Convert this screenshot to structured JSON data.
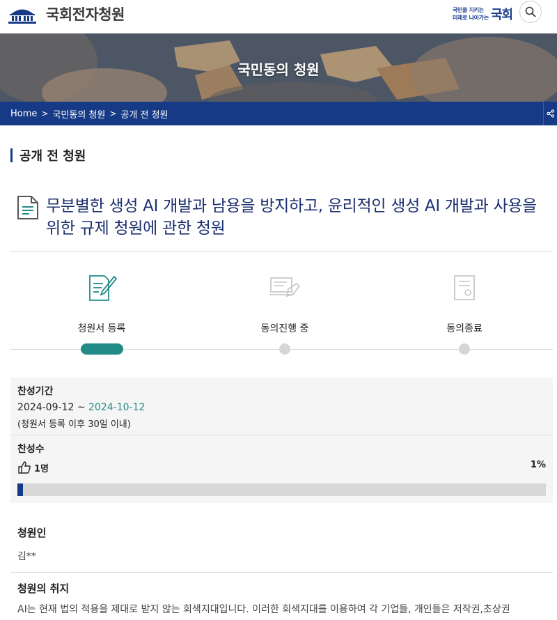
{
  "header": {
    "site_title": "국회전자청원",
    "slogan_line1": "국민을 지키는",
    "slogan_line2": "미래로 나아가는",
    "slogan_big": "국회",
    "search_icon": "search-icon"
  },
  "banner": {
    "title": "국민동의 청원"
  },
  "breadcrumb": {
    "items": [
      "Home",
      "국민동의 청원",
      "공개 전 청원"
    ],
    "separator": ">"
  },
  "section": {
    "title": "공개 전 청원"
  },
  "petition": {
    "title": "무분별한 생성 AI 개발과 남용을 방지하고, 윤리적인 생성 AI 개발과 사용을 위한 규제 청원에 관한 청원"
  },
  "steps": {
    "items": [
      {
        "label": "청원서 등록",
        "icon": "document-pen-icon",
        "active": true
      },
      {
        "label": "동의진행 중",
        "icon": "signing-icon",
        "active": false
      },
      {
        "label": "동의종료",
        "icon": "certificate-icon",
        "active": false
      }
    ]
  },
  "agreement": {
    "period_heading": "찬성기간",
    "period_start": "2024-09-12",
    "period_sep": "~",
    "period_end": "2024-10-12",
    "period_note": "(청원서 등록 이후 30일 이내)",
    "count_heading": "찬성수",
    "count_value": "1명",
    "percent_label": "1%",
    "progress_fraction": 0.01,
    "colors": {
      "accent": "#238b87",
      "navy": "#163a86"
    }
  },
  "petitioner": {
    "heading": "청원인",
    "name": "김**"
  },
  "purpose": {
    "heading": "청원의 취지",
    "text": "AI는 현재 법의 적용을 제대로 받지 않는 회색지대입니다. 이러한 회색지대를 이용하여 각 기업들, 개인들은 저작권,초상권"
  }
}
